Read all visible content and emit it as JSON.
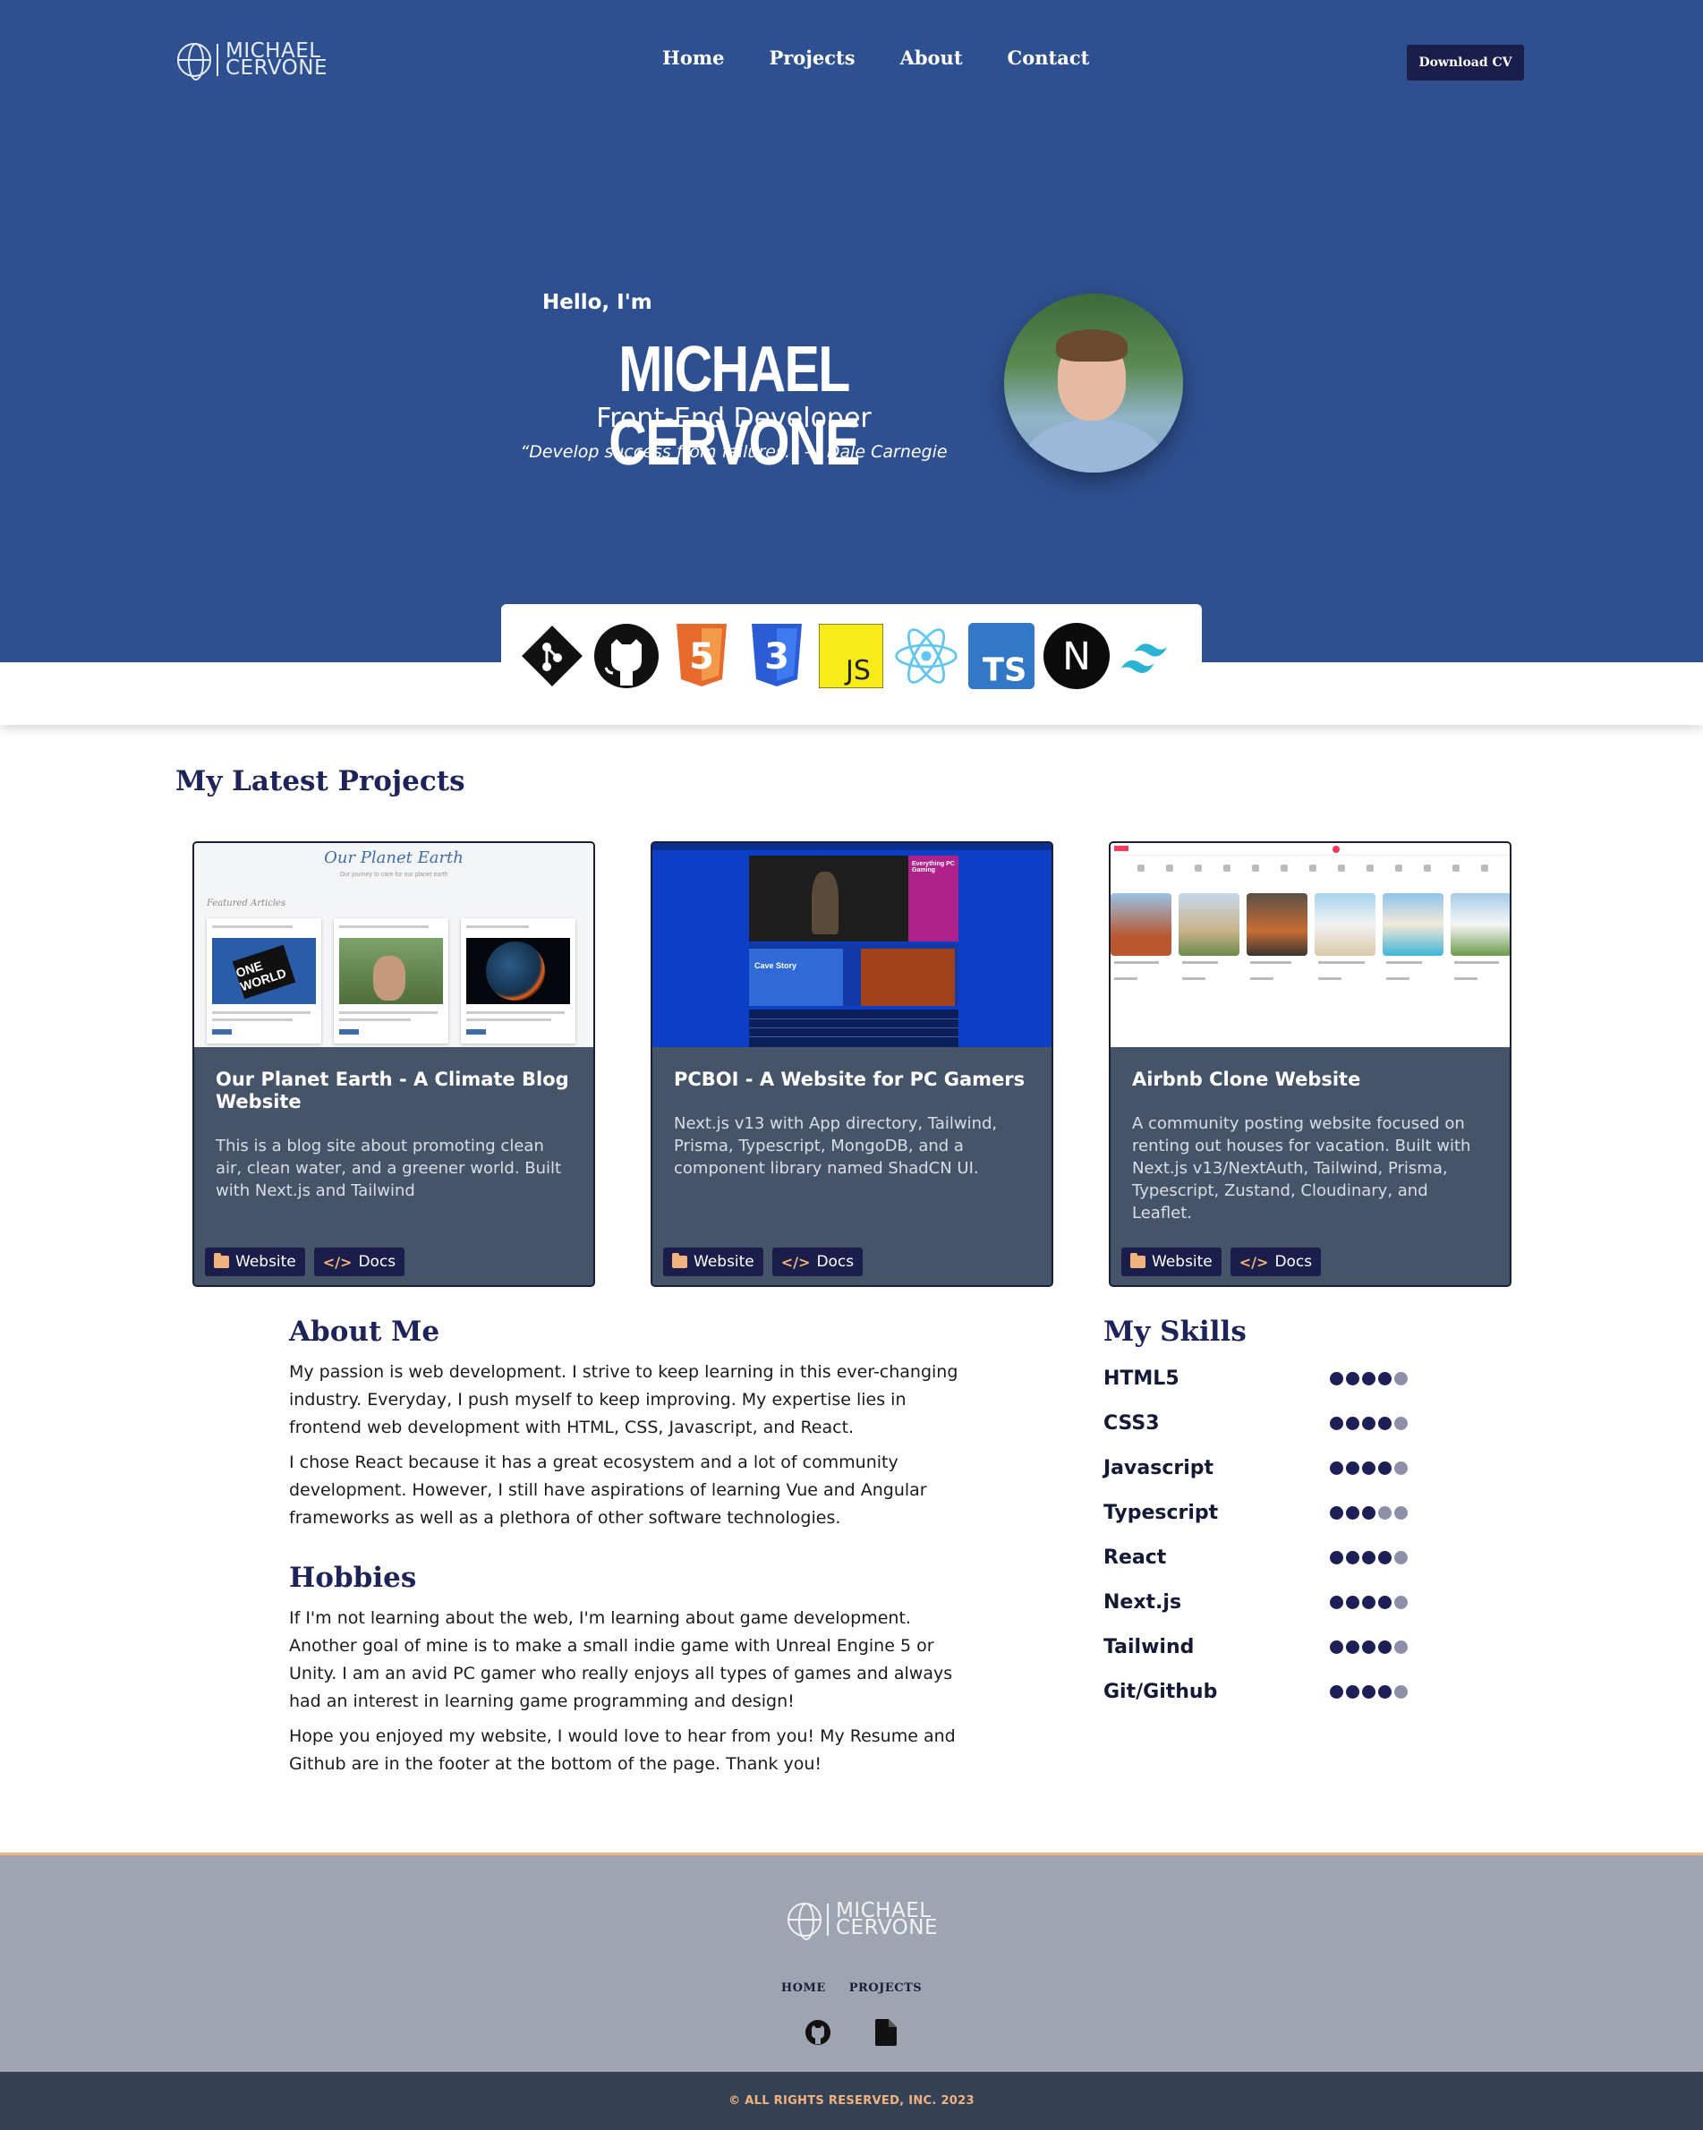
{
  "brand": {
    "line1": "MICHAEL",
    "line2": "CERVONE"
  },
  "nav": {
    "home": "Home",
    "projects": "Projects",
    "about": "About",
    "contact": "Contact"
  },
  "cv_button": "Download CV",
  "hero": {
    "greeting": "Hello, I'm",
    "name": "MICHAEL CERVONE",
    "role": "Front-End Developer",
    "quote": "“Develop success from failures.” — Dale Carnegie"
  },
  "tech_icons": [
    "git-icon",
    "github-icon",
    "html5-icon",
    "css3-icon",
    "javascript-icon",
    "react-icon",
    "typescript-icon",
    "nextjs-icon",
    "tailwind-icon"
  ],
  "tech_text": {
    "html": "5",
    "css": "3",
    "js": "JS",
    "ts": "TS",
    "next": "N"
  },
  "projects": {
    "title": "My Latest Projects",
    "items": [
      {
        "title": "Our Planet Earth - A Climate Blog Website",
        "description": "This is a blog site about promoting clean air, clean water, and a greener world. Built with Next.js and Tailwind",
        "website": "Website",
        "docs": "Docs",
        "thumb": {
          "title": "Our Planet Earth",
          "subtitle": "Our journey to care for our planet earth",
          "featured": "Featured Articles",
          "card1_text": "ONE WORLD"
        }
      },
      {
        "title": "PCBOI - A Website for PC Gamers",
        "description": "Next.js v13 with App directory, Tailwind, Prisma, Typescript, MongoDB, and a component library named ShadCN UI.",
        "website": "Website",
        "docs": "Docs",
        "thumb": {
          "banner": "Everything PC Gaming",
          "game": "Cave Story"
        }
      },
      {
        "title": "Airbnb Clone Website",
        "description": "A community posting website focused on renting out houses for vacation. Built with Next.js v13/NextAuth, Tailwind, Prisma, Typescript, Zustand, Cloudinary, and Leaflet.",
        "website": "Website",
        "docs": "Docs"
      }
    ]
  },
  "about": {
    "title": "About Me",
    "p1": "My passion is web development. I strive to keep learning in this ever-changing industry. Everyday, I push myself to keep improving. My expertise lies in frontend web development with HTML, CSS, Javascript, and React.",
    "p2": "I chose React because it has a great ecosystem and a lot of community development. However, I still have aspirations of learning Vue and Angular frameworks as well as a plethora of other software technologies."
  },
  "hobbies": {
    "title": "Hobbies",
    "p1": "If I'm not learning about the web, I'm learning about game development. Another goal of mine is to make a small indie game with Unreal Engine 5 or Unity. I am an avid PC gamer who really enjoys all types of games and always had an interest in learning game programming and design!",
    "p2": "Hope you enjoyed my website, I would love to hear from you! My Resume and Github are in the footer at the bottom of the page. Thank you!"
  },
  "skills": {
    "title": "My Skills",
    "items": [
      {
        "name": "HTML5",
        "level": 4,
        "max": 5
      },
      {
        "name": "CSS3",
        "level": 4,
        "max": 5
      },
      {
        "name": "Javascript",
        "level": 4,
        "max": 5
      },
      {
        "name": "Typescript",
        "level": 3,
        "max": 5
      },
      {
        "name": "React",
        "level": 4,
        "max": 5
      },
      {
        "name": "Next.js",
        "level": 4,
        "max": 5
      },
      {
        "name": "Tailwind",
        "level": 4,
        "max": 5
      },
      {
        "name": "Git/Github",
        "level": 4,
        "max": 5
      }
    ]
  },
  "footer": {
    "links": {
      "home": "HOME",
      "projects": "PROJECTS"
    },
    "icons": [
      "github-icon",
      "resume-file-icon"
    ],
    "copyright": "© ALL RIGHTS RESERVED, INC. 2023"
  },
  "colors": {
    "hero_bg": "#2f5090",
    "navy": "#1b1d4a",
    "card_bg": "#465469",
    "accent": "#f2b27e",
    "footer_bg": "#9ea4b0",
    "copyright_bg": "#354256"
  }
}
